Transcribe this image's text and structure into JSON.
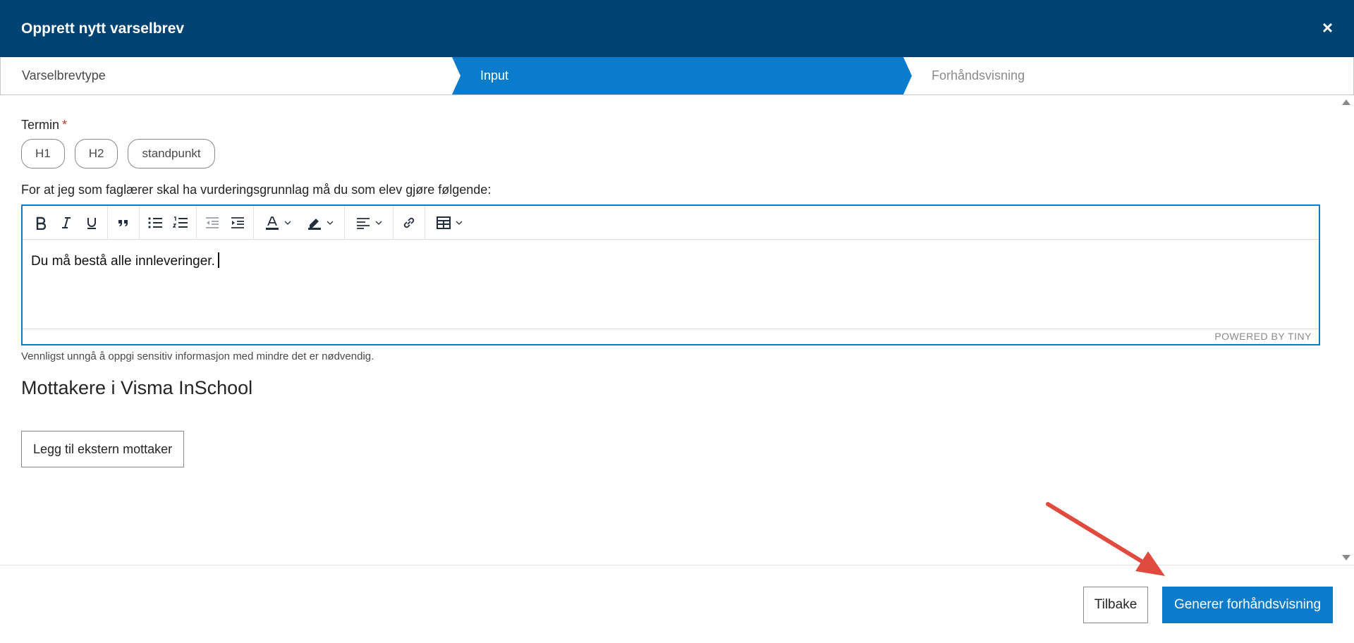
{
  "header": {
    "title": "Opprett nytt varselbrev",
    "close_symbol": "×"
  },
  "wizard": {
    "steps": [
      {
        "label": "Varselbrevtype",
        "state": "done"
      },
      {
        "label": "Input",
        "state": "active"
      },
      {
        "label": "Forhåndsvisning",
        "state": "upcoming"
      }
    ]
  },
  "form": {
    "termin_label": "Termin",
    "required_marker": "*",
    "termin_options": [
      "H1",
      "H2",
      "standpunkt"
    ],
    "instruction_label": "For at jeg som faglærer skal ha vurderingsgrunnlag må du som elev gjøre følgende:",
    "editor": {
      "content": "Du må bestå alle innleveringer.",
      "branding": "POWERED BY TINY",
      "toolbar": [
        "bold-icon",
        "italic-icon",
        "underline-icon",
        "blockquote-icon",
        "bullet-list-icon",
        "numbered-list-icon",
        "outdent-icon",
        "indent-icon",
        "text-color-icon",
        "highlight-icon",
        "align-icon",
        "link-icon",
        "table-icon"
      ]
    },
    "hint": "Vennligst unngå å oppgi sensitiv informasjon med mindre det er nødvendig.",
    "recipients_title": "Mottakere i Visma InSchool",
    "add_external_label": "Legg til ekstern mottaker"
  },
  "footer": {
    "back_label": "Tilbake",
    "generate_label": "Generer forhåndsvisning"
  },
  "colors": {
    "header": "#004372",
    "accent": "#0a7ccb",
    "arrow": "#e04a3f"
  }
}
